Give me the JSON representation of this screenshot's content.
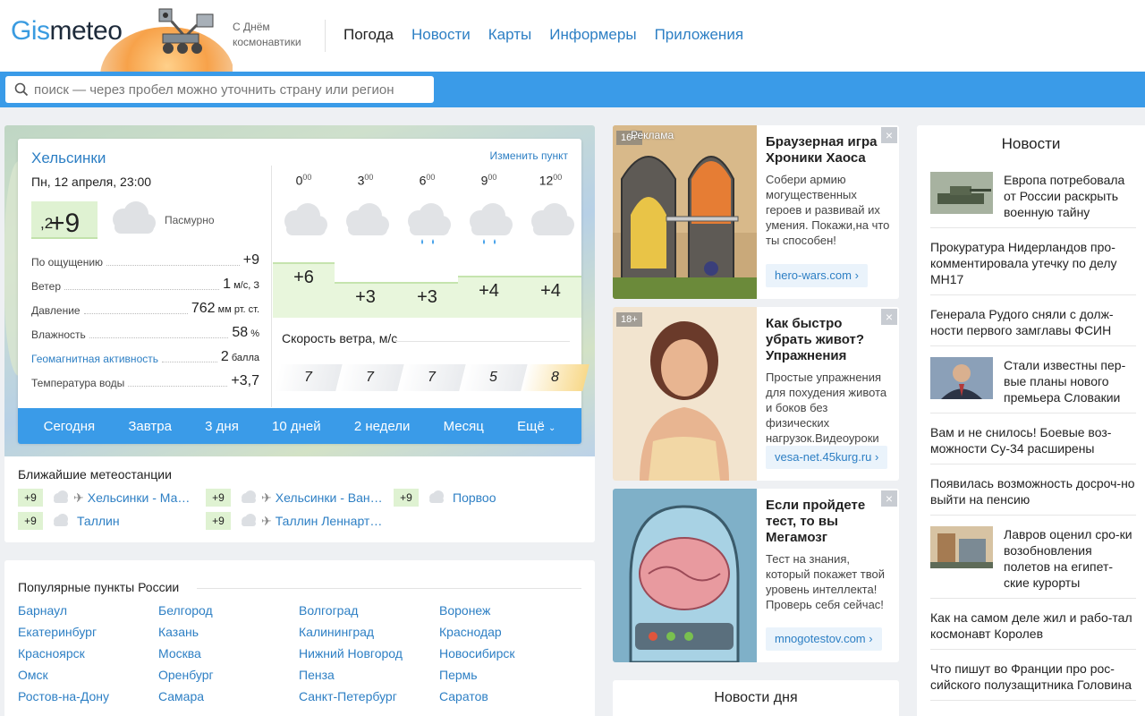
{
  "header": {
    "logo_part1": "Gis",
    "logo_part2": "meteo",
    "cosmonautics_line1": "С Днём",
    "cosmonautics_line2": "космонавтики",
    "nav": [
      "Погода",
      "Новости",
      "Карты",
      "Информеры",
      "Приложения"
    ]
  },
  "search": {
    "placeholder": "поиск — через пробел можно уточнить страну или регион"
  },
  "weather": {
    "city": "Хельсинки",
    "change_label": "Изменить пункт",
    "datetime": "Пн, 12 апреля, 23:00",
    "temp_int": "+9",
    "temp_frac": ",2",
    "condition": "Пасмурно",
    "params": [
      {
        "label": "По ощущению",
        "value": "+9",
        "unit": ""
      },
      {
        "label": "Ветер",
        "value": "1",
        "unit": " м/с, З"
      },
      {
        "label": "Давление",
        "value": "762",
        "unit": " мм рт. ст."
      },
      {
        "label": "Влажность",
        "value": "58",
        "unit": " %"
      },
      {
        "label": "Геомагнитная активность",
        "value": "2",
        "unit": " балла"
      },
      {
        "label": "Температура воды",
        "value": "+3,7",
        "unit": ""
      }
    ],
    "hours": [
      {
        "h": "0",
        "m": "00",
        "temp": "+6",
        "icon": "cloud-icon",
        "wind": "7"
      },
      {
        "h": "3",
        "m": "00",
        "temp": "+3",
        "icon": "cloud-icon",
        "wind": "7"
      },
      {
        "h": "6",
        "m": "00",
        "temp": "+3",
        "icon": "cloud-rain-icon",
        "wind": "7"
      },
      {
        "h": "9",
        "m": "00",
        "temp": "+4",
        "icon": "cloud-rain-icon",
        "wind": "5"
      },
      {
        "h": "12",
        "m": "00",
        "temp": "+4",
        "icon": "cloud-icon",
        "wind": "8"
      }
    ],
    "wind_label": "Скорость ветра, м/с",
    "tabs": [
      "Сегодня",
      "Завтра",
      "3 дня",
      "10 дней",
      "2 недели",
      "Месяц",
      "Ещё"
    ]
  },
  "stations": {
    "title": "Ближайшие метеостанции",
    "items": [
      {
        "temp": "+9",
        "name": "Хельсинки - Ма…",
        "airport": true
      },
      {
        "temp": "+9",
        "name": "Хельсинки - Ван…",
        "airport": true
      },
      {
        "temp": "+9",
        "name": "Порвоо",
        "airport": false
      },
      {
        "temp": "+9",
        "name": "Таллин",
        "airport": false
      },
      {
        "temp": "+9",
        "name": "Таллин Леннарт…",
        "airport": true
      }
    ]
  },
  "popular": {
    "title": "Популярные пункты России",
    "cities": [
      "Барнаул",
      "Белгород",
      "Волгоград",
      "Воронеж",
      "Екатеринбург",
      "Казань",
      "Калининград",
      "Краснодар",
      "Красноярск",
      "Москва",
      "Нижний Новгород",
      "Новосибирск",
      "Омск",
      "Оренбург",
      "Пенза",
      "Пермь",
      "Ростов-на-Дону",
      "Самара",
      "Санкт-Петербург",
      "Саратов"
    ]
  },
  "ads": [
    {
      "age": "16+",
      "ad_label": "Реклама",
      "title": "Браузерная игра Хроники Хаоса",
      "desc": "Собери армию могущественных героев и развивай их умения. Покажи,на что ты способен!",
      "link": "hero-wars.com ›"
    },
    {
      "age": "18+",
      "title": "Как быстро убрать живот? Упражнения",
      "desc": "Простые упражнения для похудения живота и боков без физических нагрузок.Видеоуроки",
      "link": "vesa-net.45kurg.ru ›"
    },
    {
      "title": "Если пройдете тест, то вы Мегамозг",
      "desc": "Тест на знания, который покажет твой уровень интеллекта! Проверь себя сейчас!",
      "link": "mnogotestov.com ›"
    }
  ],
  "news_of_day": "Новости дня",
  "news": {
    "title": "Новости",
    "items": [
      {
        "text": "Европа потребовала от России раскрыть военную тайну",
        "thumb": "tank"
      },
      {
        "text": "Прокуратура Нидерландов про-комментировала утечку по делу МН17",
        "thumb": ""
      },
      {
        "text": "Генерала Рудого сняли с долж-ности первого замглавы ФСИН",
        "thumb": ""
      },
      {
        "text": "Стали известны пер-вые планы нового премьера Словакии",
        "thumb": "person"
      },
      {
        "text": "Вам и не снилось! Боевые воз-можности Су-34 расширены",
        "thumb": ""
      },
      {
        "text": "Появилась возможность досроч-но выйти на пенсию",
        "thumb": ""
      },
      {
        "text": "Лавров оценил сро-ки возобновления полетов на египет-ские курорты",
        "thumb": "building"
      },
      {
        "text": "Как на самом деле жил и рабо-тал космонавт Королев",
        "thumb": ""
      },
      {
        "text": "Что пишут во Франции про рос-сийского полузащитника Головина",
        "thumb": ""
      }
    ]
  },
  "colors": {
    "accent": "#3a9be8",
    "link": "#2d7fc4",
    "temp_bg": "#dff2d2"
  }
}
